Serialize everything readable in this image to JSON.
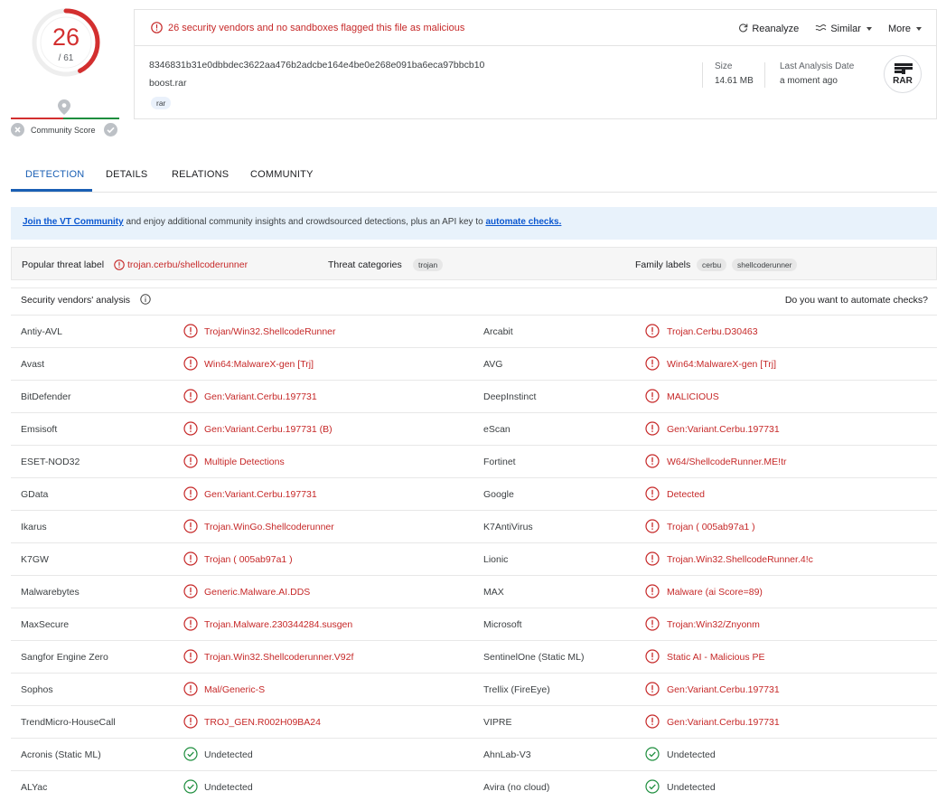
{
  "score": {
    "detections": "26",
    "total": "/ 61",
    "community_label": "Community Score",
    "detected_fraction": 0.426
  },
  "file": {
    "alert": "26 security vendors and no sandboxes flagged this file as malicious",
    "actions": {
      "reanalyze": "Reanalyze",
      "similar": "Similar",
      "more": "More"
    },
    "hash": "8346831b31e0dbbdec3622aa476b2adcbe164e4be0e268e091ba6eca97bbcb10",
    "name": "boost.rar",
    "tag": "rar",
    "size_label": "Size",
    "size_value": "14.61 MB",
    "date_label": "Last Analysis Date",
    "date_value": "a moment ago",
    "type_badge": "RAR"
  },
  "tabs": [
    "DETECTION",
    "DETAILS",
    "RELATIONS",
    "COMMUNITY"
  ],
  "banner": {
    "link": "Join the VT Community",
    "text": " and enjoy additional community insights and crowdsourced detections, plus an API key to ",
    "link2": "automate checks."
  },
  "threat": {
    "popular_label": "Popular threat label",
    "popular_value": "trojan.cerbu/shellcoderunner",
    "categories_label": "Threat categories",
    "categories": [
      "trojan"
    ],
    "family_label": "Family labels",
    "families": [
      "cerbu",
      "shellcoderunner"
    ]
  },
  "vendors_header": {
    "title": "Security vendors' analysis",
    "right": "Do you want to automate checks?"
  },
  "vendors": [
    [
      {
        "name": "Antiy-AVL",
        "result": "Trojan/Win32.ShellcodeRunner",
        "status": "malicious"
      },
      {
        "name": "Arcabit",
        "result": "Trojan.Cerbu.D30463",
        "status": "malicious"
      }
    ],
    [
      {
        "name": "Avast",
        "result": "Win64:MalwareX-gen [Trj]",
        "status": "malicious"
      },
      {
        "name": "AVG",
        "result": "Win64:MalwareX-gen [Trj]",
        "status": "malicious"
      }
    ],
    [
      {
        "name": "BitDefender",
        "result": "Gen:Variant.Cerbu.197731",
        "status": "malicious"
      },
      {
        "name": "DeepInstinct",
        "result": "MALICIOUS",
        "status": "malicious"
      }
    ],
    [
      {
        "name": "Emsisoft",
        "result": "Gen:Variant.Cerbu.197731 (B)",
        "status": "malicious"
      },
      {
        "name": "eScan",
        "result": "Gen:Variant.Cerbu.197731",
        "status": "malicious"
      }
    ],
    [
      {
        "name": "ESET-NOD32",
        "result": "Multiple Detections",
        "status": "malicious"
      },
      {
        "name": "Fortinet",
        "result": "W64/ShellcodeRunner.ME!tr",
        "status": "malicious"
      }
    ],
    [
      {
        "name": "GData",
        "result": "Gen:Variant.Cerbu.197731",
        "status": "malicious"
      },
      {
        "name": "Google",
        "result": "Detected",
        "status": "malicious"
      }
    ],
    [
      {
        "name": "Ikarus",
        "result": "Trojan.WinGo.Shellcoderunner",
        "status": "malicious"
      },
      {
        "name": "K7AntiVirus",
        "result": "Trojan ( 005ab97a1 )",
        "status": "malicious"
      }
    ],
    [
      {
        "name": "K7GW",
        "result": "Trojan ( 005ab97a1 )",
        "status": "malicious"
      },
      {
        "name": "Lionic",
        "result": "Trojan.Win32.ShellcodeRunner.4!c",
        "status": "malicious"
      }
    ],
    [
      {
        "name": "Malwarebytes",
        "result": "Generic.Malware.AI.DDS",
        "status": "malicious"
      },
      {
        "name": "MAX",
        "result": "Malware (ai Score=89)",
        "status": "malicious"
      }
    ],
    [
      {
        "name": "MaxSecure",
        "result": "Trojan.Malware.230344284.susgen",
        "status": "malicious"
      },
      {
        "name": "Microsoft",
        "result": "Trojan:Win32/Znyonm",
        "status": "malicious"
      }
    ],
    [
      {
        "name": "Sangfor Engine Zero",
        "result": "Trojan.Win32.Shellcoderunner.V92f",
        "status": "malicious"
      },
      {
        "name": "SentinelOne (Static ML)",
        "result": "Static AI - Malicious PE",
        "status": "malicious"
      }
    ],
    [
      {
        "name": "Sophos",
        "result": "Mal/Generic-S",
        "status": "malicious"
      },
      {
        "name": "Trellix (FireEye)",
        "result": "Gen:Variant.Cerbu.197731",
        "status": "malicious"
      }
    ],
    [
      {
        "name": "TrendMicro-HouseCall",
        "result": "TROJ_GEN.R002H09BA24",
        "status": "malicious"
      },
      {
        "name": "VIPRE",
        "result": "Gen:Variant.Cerbu.197731",
        "status": "malicious"
      }
    ],
    [
      {
        "name": "Acronis (Static ML)",
        "result": "Undetected",
        "status": "undetected"
      },
      {
        "name": "AhnLab-V3",
        "result": "Undetected",
        "status": "undetected"
      }
    ],
    [
      {
        "name": "ALYac",
        "result": "Undetected",
        "status": "undetected"
      },
      {
        "name": "Avira (no cloud)",
        "result": "Undetected",
        "status": "undetected"
      }
    ]
  ],
  "colors": {
    "malicious": "#c62828",
    "accent": "#1a5fb4",
    "undetected": "#1e8e3e"
  }
}
